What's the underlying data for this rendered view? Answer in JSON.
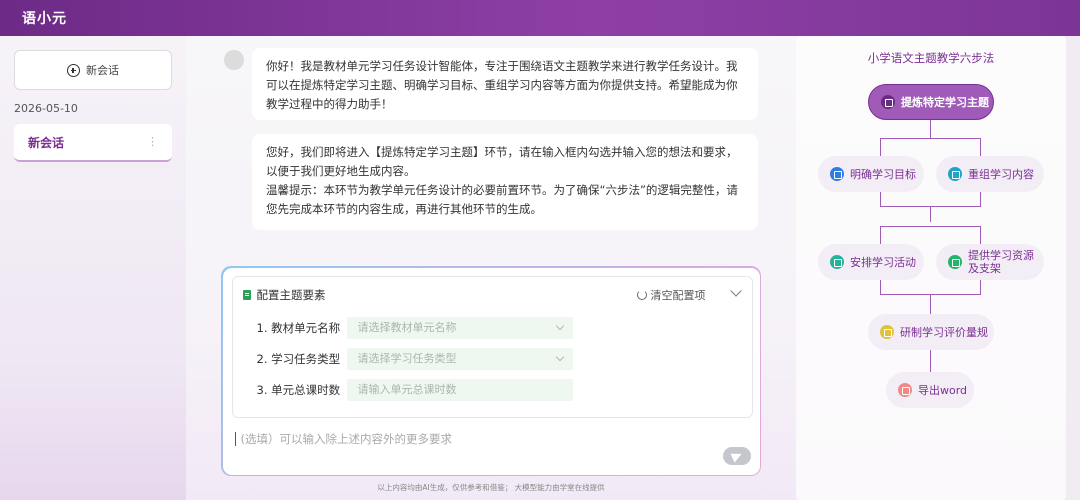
{
  "app": {
    "title": "语小元"
  },
  "sidebar": {
    "new_chat_label": "新会话",
    "date": "2026-05-10",
    "sessions": [
      {
        "label": "新会话",
        "menu": "⋮"
      }
    ]
  },
  "chat": {
    "messages": [
      {
        "role": "assistant",
        "text": "你好！我是教材单元学习任务设计智能体，专注于围绕语文主题教学来进行教学任务设计。我可以在提炼特定学习主题、明确学习目标、重组学习内容等方面为你提供支持。希望能成为你教学过程中的得力助手！"
      },
      {
        "role": "assistant",
        "lines": [
          "您好，我们即将进入【提炼特定学习主题】环节，请在输入框内勾选并输入您的想法和要求，以便于我们更好地生成内容。",
          "温馨提示：本环节为教学单元任务设计的必要前置环节。为了确保“六步法”的逻辑完整性，请您先完成本环节的内容生成，再进行其他环节的生成。"
        ]
      }
    ]
  },
  "config": {
    "title": "配置主题要素",
    "reset_label": "清空配置项",
    "fields": [
      {
        "label": "1.  教材单元名称",
        "placeholder": "请选择教材单元名称",
        "type": "select"
      },
      {
        "label": "2.  学习任务类型",
        "placeholder": "请选择学习任务类型",
        "type": "select"
      },
      {
        "label": "3.  单元总课时数",
        "placeholder": "请输入单元总课时数",
        "type": "input"
      }
    ],
    "extra_placeholder": "(选填）可以输入除上述内容外的更多要求"
  },
  "footer_note": "以上内容均由AI生成，仅供参考和借鉴； 大模型能力由学堂在线提供",
  "flow": {
    "title": "小学语文主题教学六步法",
    "steps": {
      "s1": {
        "label": "提炼特定学习主题",
        "color": "#9b59b6"
      },
      "s2": {
        "label": "明确学习目标",
        "color": "#2f7de1"
      },
      "s3": {
        "label": "重组学习内容",
        "color": "#1fa3c9"
      },
      "s4": {
        "label": "安排学习活动",
        "color": "#27b39a"
      },
      "s5a": {
        "label": "提供学习资源",
        "color": "#27b36a"
      },
      "s5b": {
        "label": "及支架"
      },
      "s6": {
        "label": "研制学习评价量规",
        "color": "#e0c23a"
      },
      "s7": {
        "label": "导出word",
        "color": "#f08a8a"
      }
    }
  }
}
